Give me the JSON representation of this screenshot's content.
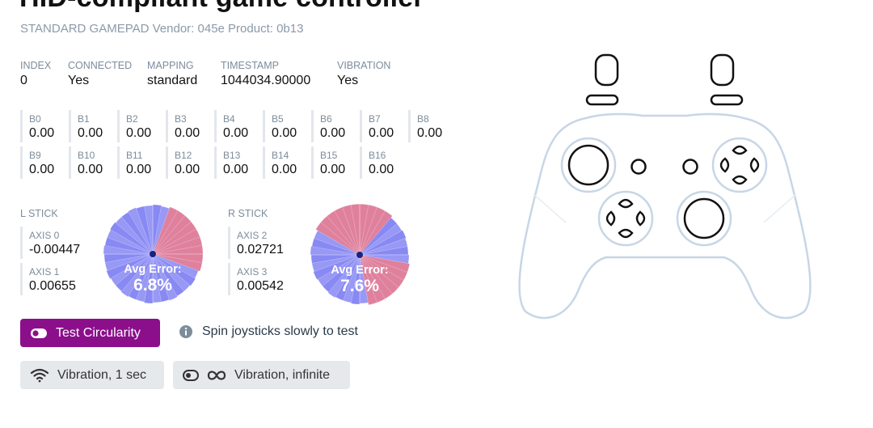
{
  "header": {
    "title": "HID-compliant game controller",
    "subtitle": "STANDARD GAMEPAD Vendor: 045e Product: 0b13"
  },
  "info": [
    {
      "key": "INDEX",
      "value": "0"
    },
    {
      "key": "CONNECTED",
      "value": "Yes"
    },
    {
      "key": "MAPPING",
      "value": "standard"
    },
    {
      "key": "TIMESTAMP",
      "value": "1044034.90000"
    },
    {
      "key": "VIBRATION",
      "value": "Yes"
    }
  ],
  "buttons": [
    {
      "key": "B0",
      "value": "0.00"
    },
    {
      "key": "B1",
      "value": "0.00"
    },
    {
      "key": "B2",
      "value": "0.00"
    },
    {
      "key": "B3",
      "value": "0.00"
    },
    {
      "key": "B4",
      "value": "0.00"
    },
    {
      "key": "B5",
      "value": "0.00"
    },
    {
      "key": "B6",
      "value": "0.00"
    },
    {
      "key": "B7",
      "value": "0.00"
    },
    {
      "key": "B8",
      "value": "0.00"
    },
    {
      "key": "B9",
      "value": "0.00"
    },
    {
      "key": "B10",
      "value": "0.00"
    },
    {
      "key": "B11",
      "value": "0.00"
    },
    {
      "key": "B12",
      "value": "0.00"
    },
    {
      "key": "B13",
      "value": "0.00"
    },
    {
      "key": "B14",
      "value": "0.00"
    },
    {
      "key": "B15",
      "value": "0.00"
    },
    {
      "key": "B16",
      "value": "0.00"
    }
  ],
  "sticks": {
    "left": {
      "label": "L STICK",
      "axes": [
        {
          "key": "AXIS 0",
          "value": "-0.00447"
        },
        {
          "key": "AXIS 1",
          "value": "0.00655"
        }
      ],
      "error_label": "Avg Error:",
      "error_value": "6.8%"
    },
    "right": {
      "label": "R STICK",
      "axes": [
        {
          "key": "AXIS 2",
          "value": "0.02721"
        },
        {
          "key": "AXIS 3",
          "value": "0.00542"
        }
      ],
      "error_label": "Avg Error:",
      "error_value": "7.6%"
    }
  },
  "actions": {
    "test_circularity_label": "Test Circularity",
    "hint_text": "Spin joysticks slowly to test",
    "vibration_1sec_label": "Vibration, 1 sec",
    "vibration_infinite_label": "Vibration, infinite"
  },
  "icons": {
    "toggle": "toggle-icon",
    "info": "info-icon",
    "wifi": "wifi-icon",
    "infinity": "infinity-icon"
  },
  "colors": {
    "accent": "#8b0f8b",
    "chart_blue": "#7b7cf2",
    "chart_red": "#d96b8c",
    "outline": "#c7d6e6"
  }
}
